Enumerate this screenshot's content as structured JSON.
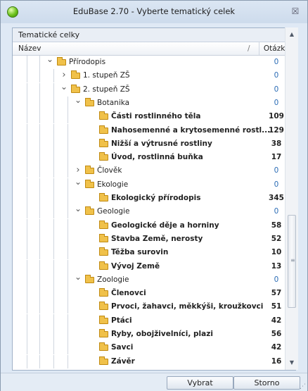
{
  "window": {
    "title": "EduBase 2.70 - Vyberte tematický celek",
    "close_glyph": "☒"
  },
  "panel": {
    "header": "Tematické celky",
    "columns": {
      "name": "Název",
      "sort_glyph": "/",
      "count": "Otázky"
    }
  },
  "tree": [
    {
      "label": "Přírodopis",
      "count": "0",
      "level": 0,
      "state": "expanded",
      "leaf": false
    },
    {
      "label": "1. stupeň ZŠ",
      "count": "0",
      "level": 1,
      "state": "collapsed",
      "leaf": false
    },
    {
      "label": "2. stupeň ZŠ",
      "count": "0",
      "level": 1,
      "state": "expanded",
      "leaf": false
    },
    {
      "label": "Botanika",
      "count": "0",
      "level": 2,
      "state": "expanded",
      "leaf": false
    },
    {
      "label": "Části rostlinného těla",
      "count": "109",
      "level": 3,
      "state": "none",
      "leaf": true
    },
    {
      "label": "Nahosemenné a krytosemenné rostl...",
      "count": "129",
      "level": 3,
      "state": "none",
      "leaf": true
    },
    {
      "label": "Nižší a výtrusné rostliny",
      "count": "38",
      "level": 3,
      "state": "none",
      "leaf": true
    },
    {
      "label": "Úvod, rostlinná buňka",
      "count": "17",
      "level": 3,
      "state": "none",
      "leaf": true
    },
    {
      "label": "Člověk",
      "count": "0",
      "level": 2,
      "state": "collapsed",
      "leaf": false
    },
    {
      "label": "Ekologie",
      "count": "0",
      "level": 2,
      "state": "expanded",
      "leaf": false
    },
    {
      "label": "Ekologický přírodopis",
      "count": "345",
      "level": 3,
      "state": "none",
      "leaf": true
    },
    {
      "label": "Geologie",
      "count": "0",
      "level": 2,
      "state": "expanded",
      "leaf": false
    },
    {
      "label": "Geologické děje a horniny",
      "count": "58",
      "level": 3,
      "state": "none",
      "leaf": true
    },
    {
      "label": "Stavba Země, nerosty",
      "count": "52",
      "level": 3,
      "state": "none",
      "leaf": true
    },
    {
      "label": "Těžba surovin",
      "count": "10",
      "level": 3,
      "state": "none",
      "leaf": true
    },
    {
      "label": "Vývoj Země",
      "count": "13",
      "level": 3,
      "state": "none",
      "leaf": true
    },
    {
      "label": "Zoologie",
      "count": "0",
      "level": 2,
      "state": "expanded",
      "leaf": false
    },
    {
      "label": "Členovci",
      "count": "57",
      "level": 3,
      "state": "none",
      "leaf": true
    },
    {
      "label": "Prvoci, žahavci, měkkýši, kroužkovci",
      "count": "51",
      "level": 3,
      "state": "none",
      "leaf": true
    },
    {
      "label": "Ptáci",
      "count": "42",
      "level": 3,
      "state": "none",
      "leaf": true
    },
    {
      "label": "Ryby, obojživelníci, plazi",
      "count": "56",
      "level": 3,
      "state": "none",
      "leaf": true
    },
    {
      "label": "Savci",
      "count": "42",
      "level": 3,
      "state": "none",
      "leaf": true
    },
    {
      "label": "Závěr",
      "count": "16",
      "level": 3,
      "state": "none",
      "leaf": true
    }
  ],
  "scroll_position": 0.78,
  "footer": {
    "select_label": "Vybrat",
    "cancel_label": "Storno"
  },
  "colors": {
    "folder": "#f0c14a",
    "zero_count": "#2b6cb5",
    "titlebar": "#dbe6f3"
  }
}
